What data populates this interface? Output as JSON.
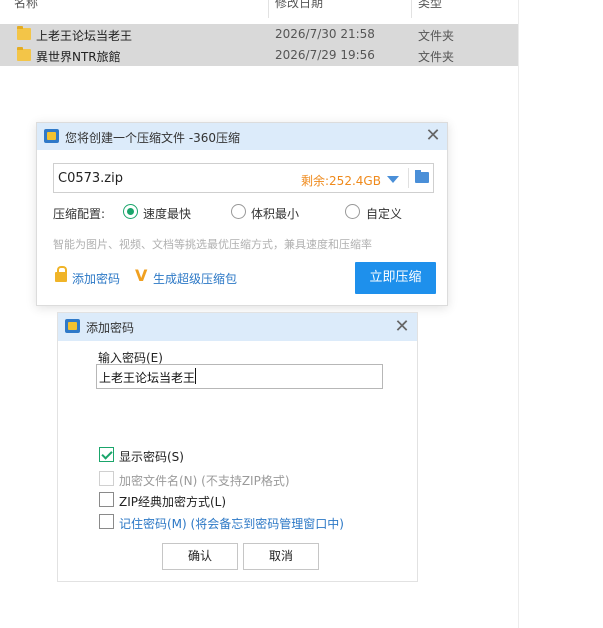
{
  "explorer": {
    "columns": {
      "name": "名称",
      "date": "修改日期",
      "type": "类型"
    },
    "files": [
      {
        "name": "上老王论坛当老王",
        "date": "2026/7/30 21:58",
        "type": "文件夹"
      },
      {
        "name": "異世界NTR旅館",
        "date": "2026/7/29 19:56",
        "type": "文件夹"
      }
    ]
  },
  "compress_dialog": {
    "title": "您将创建一个压缩文件 -360压缩",
    "filename": "C0573.zip",
    "free_space": "剩余:252.4GB",
    "config_label": "压缩配置:",
    "options": [
      "速度最快",
      "体积最小",
      "自定义"
    ],
    "selected_option": "速度最快",
    "hint": "智能为图片、视频、文档等挑选最优压缩方式，兼具速度和压缩率",
    "add_password": "添加密码",
    "super_package": "生成超级压缩包",
    "compress_now": "立即压缩",
    "colors": {
      "accent": "#1e90ec",
      "titlebar": "#dcebfa",
      "warning": "#ef8a1c",
      "radio_on": "#1aa56b"
    }
  },
  "password_dialog": {
    "title": "添加密码",
    "input_label": "输入密码(E)",
    "password_value": "上老王论坛当老王",
    "checkboxes": [
      {
        "label": "显示密码(S)",
        "checked": true,
        "disabled": false
      },
      {
        "label": "加密文件名(N) (不支持ZIP格式)",
        "checked": false,
        "disabled": true
      },
      {
        "label": "ZIP经典加密方式(L)",
        "checked": false,
        "disabled": false
      },
      {
        "label": "记住密码(M) (将会备忘到密码管理窗口中)",
        "checked": false,
        "disabled": false
      }
    ],
    "ok": "确认",
    "cancel": "取消"
  }
}
